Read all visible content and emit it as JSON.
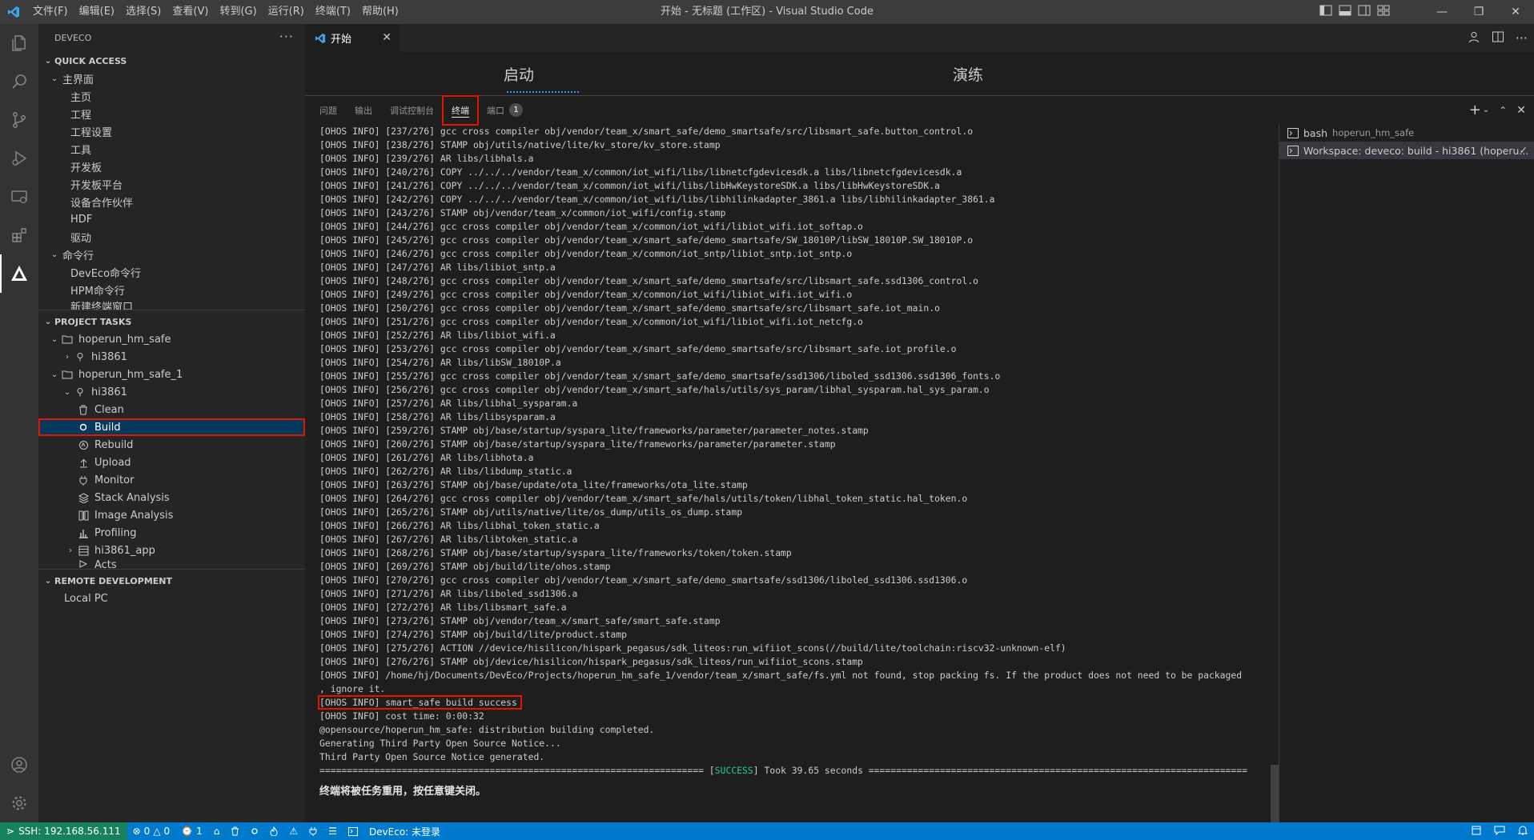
{
  "window": {
    "title": "开始 - 无标题 (工作区) - Visual Studio Code",
    "menu": [
      "文件(F)",
      "编辑(E)",
      "选择(S)",
      "查看(V)",
      "转到(G)",
      "运行(R)",
      "终端(T)",
      "帮助(H)"
    ]
  },
  "sidebar": {
    "title": "DEVECO",
    "quick_access": {
      "header": "QUICK ACCESS",
      "groups": [
        {
          "label": "主界面",
          "items": [
            "主页",
            "工程",
            "工程设置",
            "工具",
            "开发板",
            "开发板平台",
            "设备合作伙伴",
            "HDF",
            "驱动"
          ]
        },
        {
          "label": "命令行",
          "items": [
            "DevEco命令行",
            "HPM命令行",
            "新建终端窗口"
          ]
        }
      ]
    },
    "project_tasks": {
      "header": "PROJECT TASKS",
      "projects": [
        {
          "label": "hoperun_hm_safe",
          "board": "hi3861"
        },
        {
          "label": "hoperun_hm_safe_1",
          "board": "hi3861",
          "tasks": [
            "Clean",
            "Build",
            "Rebuild",
            "Upload",
            "Monitor",
            "Stack Analysis",
            "Image Analysis",
            "Profiling"
          ],
          "app": "hi3861_app",
          "extra": "Acts"
        }
      ]
    },
    "remote": {
      "header": "REMOTE DEVELOPMENT",
      "items": [
        "Local PC"
      ]
    }
  },
  "editor": {
    "tab_label": "开始",
    "welcome_start": "启动",
    "welcome_walkthrough": "演练"
  },
  "panel": {
    "tabs": [
      {
        "label": "问题"
      },
      {
        "label": "输出"
      },
      {
        "label": "调试控制台"
      },
      {
        "label": "终端"
      },
      {
        "label": "端口",
        "badge": "1"
      }
    ],
    "terminal_lines": [
      "[OHOS INFO] [237/276] gcc cross compiler obj/vendor/team_x/smart_safe/demo_smartsafe/src/libsmart_safe.button_control.o",
      "[OHOS INFO] [238/276] STAMP obj/utils/native/lite/kv_store/kv_store.stamp",
      "[OHOS INFO] [239/276] AR libs/libhals.a",
      "[OHOS INFO] [240/276] COPY ../../../vendor/team_x/common/iot_wifi/libs/libnetcfgdevicesdk.a libs/libnetcfgdevicesdk.a",
      "[OHOS INFO] [241/276] COPY ../../../vendor/team_x/common/iot_wifi/libs/libHwKeystoreSDK.a libs/libHwKeystoreSDK.a",
      "[OHOS INFO] [242/276] COPY ../../../vendor/team_x/common/iot_wifi/libs/libhilinkadapter_3861.a libs/libhilinkadapter_3861.a",
      "[OHOS INFO] [243/276] STAMP obj/vendor/team_x/common/iot_wifi/config.stamp",
      "[OHOS INFO] [244/276] gcc cross compiler obj/vendor/team_x/common/iot_wifi/libiot_wifi.iot_softap.o",
      "[OHOS INFO] [245/276] gcc cross compiler obj/vendor/team_x/smart_safe/demo_smartsafe/SW_18010P/libSW_18010P.SW_18010P.o",
      "[OHOS INFO] [246/276] gcc cross compiler obj/vendor/team_x/common/iot_sntp/libiot_sntp.iot_sntp.o",
      "[OHOS INFO] [247/276] AR libs/libiot_sntp.a",
      "[OHOS INFO] [248/276] gcc cross compiler obj/vendor/team_x/smart_safe/demo_smartsafe/src/libsmart_safe.ssd1306_control.o",
      "[OHOS INFO] [249/276] gcc cross compiler obj/vendor/team_x/common/iot_wifi/libiot_wifi.iot_wifi.o",
      "[OHOS INFO] [250/276] gcc cross compiler obj/vendor/team_x/smart_safe/demo_smartsafe/src/libsmart_safe.iot_main.o",
      "[OHOS INFO] [251/276] gcc cross compiler obj/vendor/team_x/common/iot_wifi/libiot_wifi.iot_netcfg.o",
      "[OHOS INFO] [252/276] AR libs/libiot_wifi.a",
      "[OHOS INFO] [253/276] gcc cross compiler obj/vendor/team_x/smart_safe/demo_smartsafe/src/libsmart_safe.iot_profile.o",
      "[OHOS INFO] [254/276] AR libs/libSW_18010P.a",
      "[OHOS INFO] [255/276] gcc cross compiler obj/vendor/team_x/smart_safe/demo_smartsafe/ssd1306/liboled_ssd1306.ssd1306_fonts.o",
      "[OHOS INFO] [256/276] gcc cross compiler obj/vendor/team_x/smart_safe/hals/utils/sys_param/libhal_sysparam.hal_sys_param.o",
      "[OHOS INFO] [257/276] AR libs/libhal_sysparam.a",
      "[OHOS INFO] [258/276] AR libs/libsysparam.a",
      "[OHOS INFO] [259/276] STAMP obj/base/startup/syspara_lite/frameworks/parameter/parameter_notes.stamp",
      "[OHOS INFO] [260/276] STAMP obj/base/startup/syspara_lite/frameworks/parameter/parameter.stamp",
      "[OHOS INFO] [261/276] AR libs/libhota.a",
      "[OHOS INFO] [262/276] AR libs/libdump_static.a",
      "[OHOS INFO] [263/276] STAMP obj/base/update/ota_lite/frameworks/ota_lite.stamp",
      "[OHOS INFO] [264/276] gcc cross compiler obj/vendor/team_x/smart_safe/hals/utils/token/libhal_token_static.hal_token.o",
      "[OHOS INFO] [265/276] STAMP obj/utils/native/lite/os_dump/utils_os_dump.stamp",
      "[OHOS INFO] [266/276] AR libs/libhal_token_static.a",
      "[OHOS INFO] [267/276] AR libs/libtoken_static.a",
      "[OHOS INFO] [268/276] STAMP obj/base/startup/syspara_lite/frameworks/token/token.stamp",
      "[OHOS INFO] [269/276] STAMP obj/build/lite/ohos.stamp",
      "[OHOS INFO] [270/276] gcc cross compiler obj/vendor/team_x/smart_safe/demo_smartsafe/ssd1306/liboled_ssd1306.ssd1306.o",
      "[OHOS INFO] [271/276] AR libs/liboled_ssd1306.a",
      "[OHOS INFO] [272/276] AR libs/libsmart_safe.a",
      "[OHOS INFO] [273/276] STAMP obj/vendor/team_x/smart_safe/smart_safe.stamp",
      "[OHOS INFO] [274/276] STAMP obj/build/lite/product.stamp",
      "[OHOS INFO] [275/276] ACTION //device/hisilicon/hispark_pegasus/sdk_liteos:run_wifiiot_scons(//build/lite/toolchain:riscv32-unknown-elf)",
      "[OHOS INFO] [276/276] STAMP obj/device/hisilicon/hispark_pegasus/sdk_liteos/run_wifiiot_scons.stamp",
      "[OHOS INFO] /home/hj/Documents/DevEco/Projects/hoperun_hm_safe_1/vendor/team_x/smart_safe/fs.yml not found, stop packing fs. If the product does not need to be packaged",
      ", ignore it."
    ],
    "terminal_success_line": "[OHOS INFO] smart_safe build success",
    "terminal_tail": [
      "[OHOS INFO] cost time: 0:00:32",
      "@opensource/hoperun_hm_safe: distribution building completed.",
      "Generating Third Party Open Source Notice...",
      "Third Party Open Source Notice generated."
    ],
    "success_prefix": "====================================================================== [",
    "success_word": "SUCCESS",
    "success_suffix": "] Took 39.65 seconds =====================================================================",
    "terminal_notice": "终端将被任务重用，按任意键关闭。",
    "terminal_list": [
      {
        "name": "bash",
        "sub": "hoperun_hm_safe"
      },
      {
        "name": "Workspace: deveco: build - hi3861 (hoperu..."
      }
    ]
  },
  "statusbar": {
    "remote": "SSH: 192.168.56.111",
    "errors": "0",
    "warnings": "0",
    "ports": "1",
    "deveco": "DevEco: 未登录"
  },
  "colors": {
    "accent": "#007acc",
    "remote": "#16825d",
    "highlight_box": "#e51400",
    "success": "#23d18b"
  }
}
